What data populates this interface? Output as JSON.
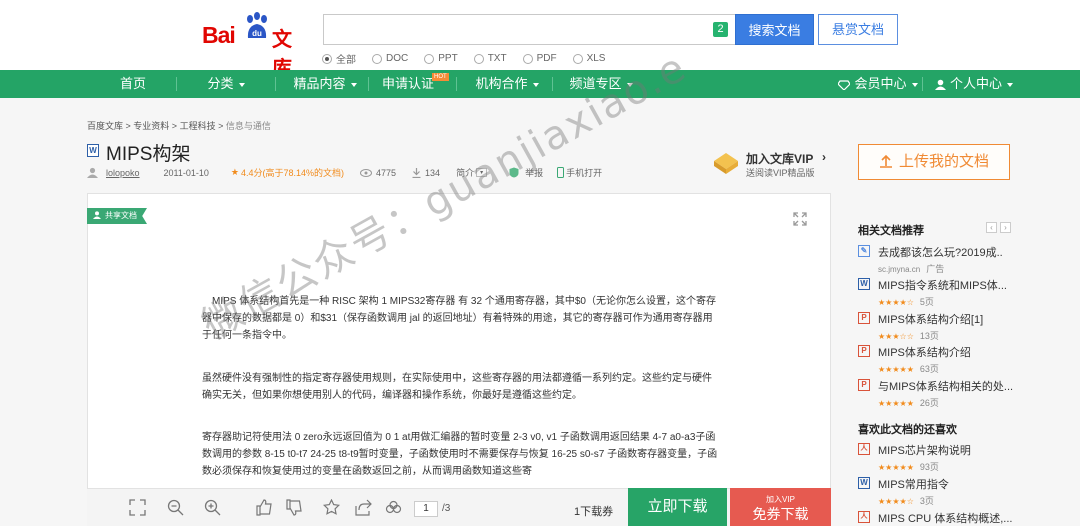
{
  "header": {
    "logo_bai": "Bai",
    "logo_du": "du",
    "logo_wenku": "文库",
    "search_badge": "2",
    "search_button": "搜索文档",
    "reward_button": "悬赏文档",
    "filters": [
      "全部",
      "DOC",
      "PPT",
      "TXT",
      "PDF",
      "XLS"
    ]
  },
  "nav": {
    "home": "首页",
    "category": "分类",
    "featured": "精品内容",
    "certify": "申请认证",
    "hot": "HOT",
    "partners": "机构合作",
    "channels": "频道专区",
    "member": "会员中心",
    "personal": "个人中心"
  },
  "breadcrumb": [
    "百度文库",
    "专业资料",
    "工程科技",
    "信息与通信"
  ],
  "doc": {
    "type_icon": "W",
    "title": "MIPS构架",
    "author": "lolopoko",
    "date": "2011-01-10",
    "rating": "4.4分(高于78.14%的文档)",
    "views": "4775",
    "downloads": "134",
    "intro": "简介",
    "report": "举报",
    "phone_open": "手机打开",
    "share_tag": "共享文档",
    "paragraphs": [
      "MIPS 体系结构首先是一种 RISC 架构 1  MIPS32寄存器  有 32 个通用寄存器，其中$0（无论你怎么设置，这个寄存器中保存的数据都是 0）和$31（保存函数调用 jal 的返回地址）有着特殊的用途，其它的寄存器可作为通用寄存器用于任何一条指令中。",
      "虽然硬件没有强制性的指定寄存器使用规则，在实际使用中，这些寄存器的用法都遵循一系列约定。这些约定与硬件确实无关，但如果你想使用别人的代码，编译器和操作系统，你最好是遵循这些约定。",
      "寄存器助记符使用法 0  zero永远返回值为 0  1  at用做汇编器的暂时变量 2-3  v0,    v1 子函数调用返回结果 4-7  a0-a3子函数调用的参数 8-15  t0-t7  24-25  t8-t9暂时变量，子函数使用时不需要保存与恢复 16-25  s0-s7 子函数寄存器变量，子函数必须保存和恢复使用过的变量在函数返回之前，从而调用函数知道这些寄"
    ],
    "watermark": "微信公众号：guanjiaxiao.e"
  },
  "vip": {
    "title": "加入文库VIP",
    "subtitle": "送阅读VIP精品版",
    "upload": "上传我的文档"
  },
  "toolbar": {
    "page_current": "1",
    "page_total": "/3",
    "coupon": "1下载券",
    "download": "立即下载",
    "vip_top": "加入VIP",
    "vip_bottom": "免券下载"
  },
  "sidebar": {
    "related_title": "相关文档推荐",
    "related": [
      {
        "icon": "ad",
        "name": "去成都该怎么玩?2019成..",
        "meta": "sc.jmyna.cn",
        "meta2": "广告"
      },
      {
        "icon": "w",
        "name": "MIPS指令系统和MIPS体...",
        "meta": "★★★★☆",
        "meta2": "5页"
      },
      {
        "icon": "p",
        "name": "MIPS体系结构介绍[1]",
        "meta": "★★★☆☆",
        "meta2": "13页"
      },
      {
        "icon": "p",
        "name": "MIPS体系结构介绍",
        "meta": "★★★★★",
        "meta2": "63页"
      },
      {
        "icon": "p",
        "name": "与MIPS体系结构相关的处...",
        "meta": "★★★★★",
        "meta2": "26页"
      }
    ],
    "liked_title": "喜欢此文档的还喜欢",
    "liked": [
      {
        "icon": "pdf",
        "name": "MIPS芯片架构说明",
        "meta": "★★★★★",
        "meta2": "93页"
      },
      {
        "icon": "w",
        "name": "MIPS常用指令",
        "meta": "★★★★☆",
        "meta2": "3页"
      },
      {
        "icon": "pdf",
        "name": "MIPS CPU 体系结构概述,...",
        "meta": "",
        "meta2": ""
      }
    ]
  },
  "colors": {
    "brand_green": "#24a466",
    "baidu_red": "#e10602",
    "search_blue": "#3a7de2",
    "orange": "#f08a34",
    "vip_red": "#e65a50"
  }
}
